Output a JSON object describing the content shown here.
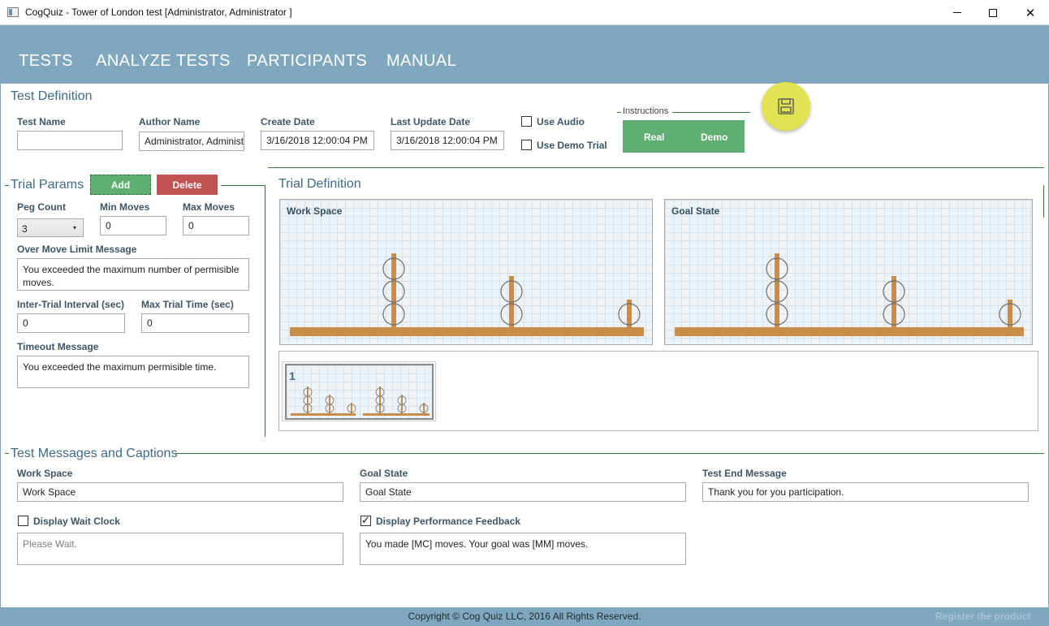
{
  "window": {
    "title": "CogQuiz - Tower of London test [Administrator, Administrator ]",
    "minimize": "—",
    "close": "✕"
  },
  "nav": {
    "items": [
      "TESTS",
      "ANALYZE TESTS",
      "PARTICIPANTS",
      "MANUAL"
    ]
  },
  "test_definition": {
    "title": "Test Definition",
    "test_name_label": "Test Name",
    "test_name_value": "",
    "author_label": "Author Name",
    "author_value": "Administrator, Administrator",
    "create_label": "Create Date",
    "create_value": "3/16/2018 12:00:04 PM",
    "update_label": "Last Update Date",
    "update_value": "3/16/2018 12:00:04 PM",
    "use_audio_label": "Use Audio",
    "use_audio_checked": false,
    "use_demo_label": "Use Demo Trial",
    "use_demo_checked": false,
    "instructions_label": "Instructions",
    "real_label": "Real",
    "demo_label": "Demo"
  },
  "trial_params": {
    "title": "Trial Params",
    "add_label": "Add",
    "delete_label": "Delete",
    "peg_count_label": "Peg Count",
    "peg_count_value": "3",
    "min_moves_label": "Min Moves",
    "min_moves_value": "0",
    "max_moves_label": "Max Moves",
    "max_moves_value": "0",
    "over_move_label": "Over Move Limit Message",
    "over_move_value": "You exceeded the maximum number of permisible moves.",
    "inter_trial_label": "Inter-Trial Interval (sec)",
    "inter_trial_value": "0",
    "max_trial_label": "Max Trial Time (sec)",
    "max_trial_value": "0",
    "timeout_label": "Timeout Message",
    "timeout_value": "You exceeded the maximum permisible time."
  },
  "trial_definition": {
    "title": "Trial Definition",
    "work_space_title": "Work Space",
    "goal_state_title": "Goal State",
    "thumbnail_number": "1"
  },
  "messages": {
    "title": "Test Messages and Captions",
    "work_space_label": "Work Space",
    "work_space_value": "Work Space",
    "goal_state_label": "Goal State",
    "goal_state_value": "Goal State",
    "end_label": "Test End Message",
    "end_value": "Thank you for you participation.",
    "wait_clock_label": "Display Wait Clock",
    "wait_clock_checked": false,
    "wait_placeholder": "Please Wait.",
    "feedback_label": "Display Performance Feedback",
    "feedback_checked": true,
    "feedback_value": "You made [MC] moves. Your goal was [MM] moves."
  },
  "footer": {
    "copyright": "Copyright © Cog Quiz LLC, 2016 All Rights Reserved.",
    "register": "Register the product"
  },
  "colors": {
    "nav": "#7fa7be",
    "accent_green": "#5fae74",
    "accent_red": "#c0524f",
    "save_fab": "#e2e352",
    "peg_wood": "#c98d4a"
  },
  "icons": [
    "app-icon",
    "save-icon",
    "chevron-down-icon",
    "check-icon"
  ]
}
